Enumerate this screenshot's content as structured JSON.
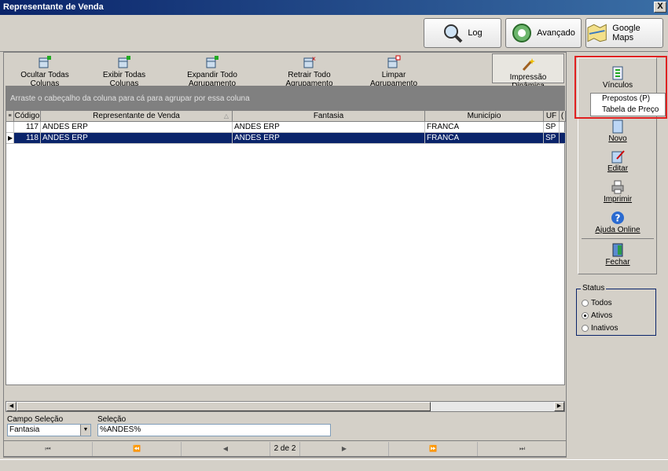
{
  "window": {
    "title": "Representante de Venda",
    "close_label": "X"
  },
  "topbuttons": {
    "log": "Log",
    "avancado": "Avançado",
    "google_maps": "Google Maps"
  },
  "toolbar": {
    "ocultar": "Ocultar Todas Colunas",
    "exibir": "Exibir Todas  Colunas",
    "expandir": "Expandir Todo Agrupamento",
    "retrair": "Retrair Todo Agrupamento",
    "limpar": "Limpar Agrupamento",
    "impressao": "Impressão Dinâmica"
  },
  "groupbar_text": "Arraste o cabeçalho da coluna para cá para agrupar por essa coluna",
  "columns": {
    "codigo": "Código",
    "representante": "Representante de Venda",
    "fantasia": "Fantasia",
    "municipio": "Município",
    "uf": "UF",
    "extra": "("
  },
  "rows": [
    {
      "codigo": "117",
      "representante": "ANDES ERP",
      "fantasia": "ANDES ERP",
      "municipio": "FRANCA",
      "uf": "SP"
    },
    {
      "codigo": "118",
      "representante": "ANDES ERP",
      "fantasia": "ANDES ERP",
      "municipio": "FRANCA",
      "uf": "SP"
    }
  ],
  "selected_row": 1,
  "filter": {
    "campo_label": "Campo Seleção",
    "campo_value": "Fantasia",
    "selecao_label": "Seleção",
    "selecao_value": "%ANDES%"
  },
  "nav": {
    "first": "⏮",
    "prev_page": "⏪",
    "prev": "◀",
    "page": "2 de 2",
    "next": "▶",
    "next_page": "⏩",
    "last": "⏭"
  },
  "side": {
    "vinculos": "Vínculos",
    "popup_items": [
      "Prepostos (P)",
      "Tabela de Preço"
    ],
    "novo": "Novo",
    "editar": "Editar",
    "imprimir": "Imprimir",
    "ajuda": "Ajuda Online",
    "fechar": "Fechar"
  },
  "status": {
    "title": "Status",
    "options": [
      "Todos",
      "Ativos",
      "Inativos"
    ],
    "selected": "Ativos"
  },
  "colors": {
    "selection": "#0a246a",
    "highlight": "#e02020"
  }
}
